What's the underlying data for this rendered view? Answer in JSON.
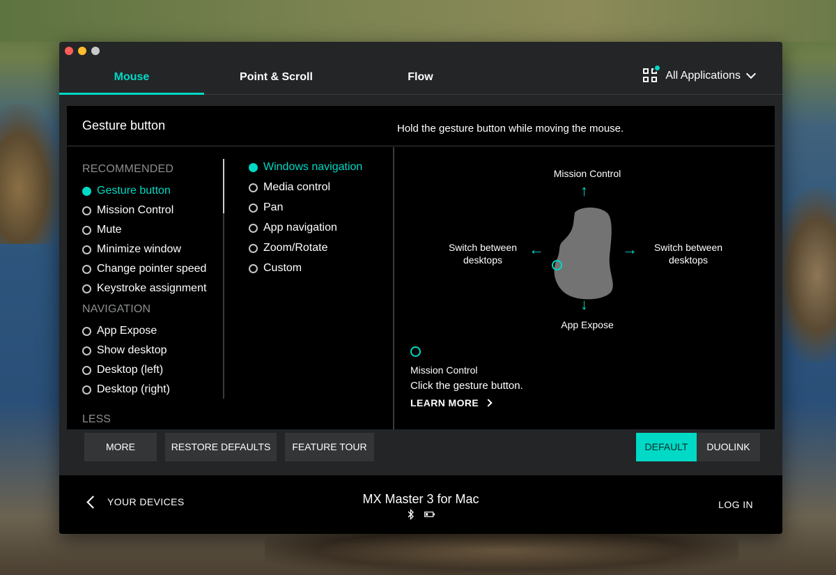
{
  "colors": {
    "accent": "#00d9c5",
    "window_bg": "#232527",
    "panel_bg": "#000000"
  },
  "tabs": [
    {
      "label": "Mouse",
      "active": true
    },
    {
      "label": "Point & Scroll",
      "active": false
    },
    {
      "label": "Flow",
      "active": false
    }
  ],
  "app_selector": {
    "label": "All Applications",
    "icon": "apps-grid-icon"
  },
  "panel": {
    "title": "Gesture button",
    "hint": "Hold the gesture button while moving the mouse."
  },
  "left_list": {
    "recommended_heading": "RECOMMENDED",
    "recommended": [
      "Gesture button",
      "Mission Control",
      "Mute",
      "Minimize window",
      "Change pointer speed",
      "Keystroke assignment"
    ],
    "navigation_heading": "NAVIGATION",
    "navigation": [
      "App Expose",
      "Show desktop",
      "Desktop (left)",
      "Desktop (right)"
    ],
    "less_label": "LESS",
    "selected": "Gesture button"
  },
  "mid_list": {
    "items": [
      "Windows navigation",
      "Media control",
      "Pan",
      "App navigation",
      "Zoom/Rotate",
      "Custom"
    ],
    "selected": "Windows navigation"
  },
  "gesture": {
    "up": "Mission Control",
    "left_line1": "Switch between",
    "left_line2": "desktops",
    "right_line1": "Switch between",
    "right_line2": "desktops",
    "down": "App Expose",
    "click_title": "Mission Control",
    "click_text": "Click the gesture button.",
    "learn_more": "LEARN MORE"
  },
  "buttons": {
    "more": "MORE",
    "restore_defaults": "RESTORE DEFAULTS",
    "feature_tour": "FEATURE TOUR",
    "default": "DEFAULT",
    "duolink": "DUOLINK"
  },
  "footer": {
    "back_label": "YOUR DEVICES",
    "device_name": "MX Master 3 for Mac",
    "status_icons": [
      "bluetooth-icon",
      "battery-icon"
    ],
    "login_label": "LOG IN"
  }
}
